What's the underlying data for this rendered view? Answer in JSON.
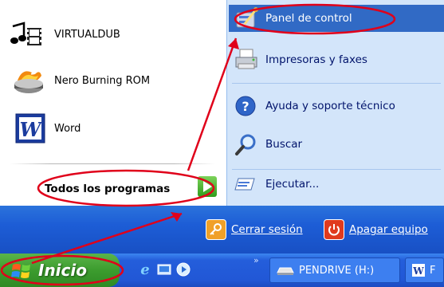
{
  "start_menu": {
    "pinned_programs": [
      {
        "label": "VIRTUALDUB",
        "icon": "virtualdub-icon"
      },
      {
        "label": "Nero Burning ROM",
        "icon": "nero-icon"
      },
      {
        "label": "Word",
        "icon": "word-icon"
      }
    ],
    "all_programs_label": "Todos los programas",
    "right_items": [
      {
        "label": "Panel de control",
        "icon": "control-panel-icon",
        "selected": true
      },
      {
        "label": "Impresoras y faxes",
        "icon": "printer-icon"
      },
      {
        "label": "Ayuda y soporte técnico",
        "icon": "help-icon"
      },
      {
        "label": "Buscar",
        "icon": "search-icon"
      },
      {
        "label": "Ejecutar...",
        "icon": "run-icon"
      }
    ],
    "logoff_label": "Cerrar sesión",
    "shutdown_label": "Apagar equipo"
  },
  "taskbar": {
    "start_label": "Inicio",
    "chevron": "»",
    "buttons": [
      {
        "label": "PENDRIVE (H:)",
        "icon": "drive-icon"
      },
      {
        "label": "F",
        "icon": "word-doc-icon"
      }
    ]
  },
  "colors": {
    "selection": "#316ac5",
    "right_pane": "#d3e5fa",
    "annotation": "#e0001a"
  }
}
